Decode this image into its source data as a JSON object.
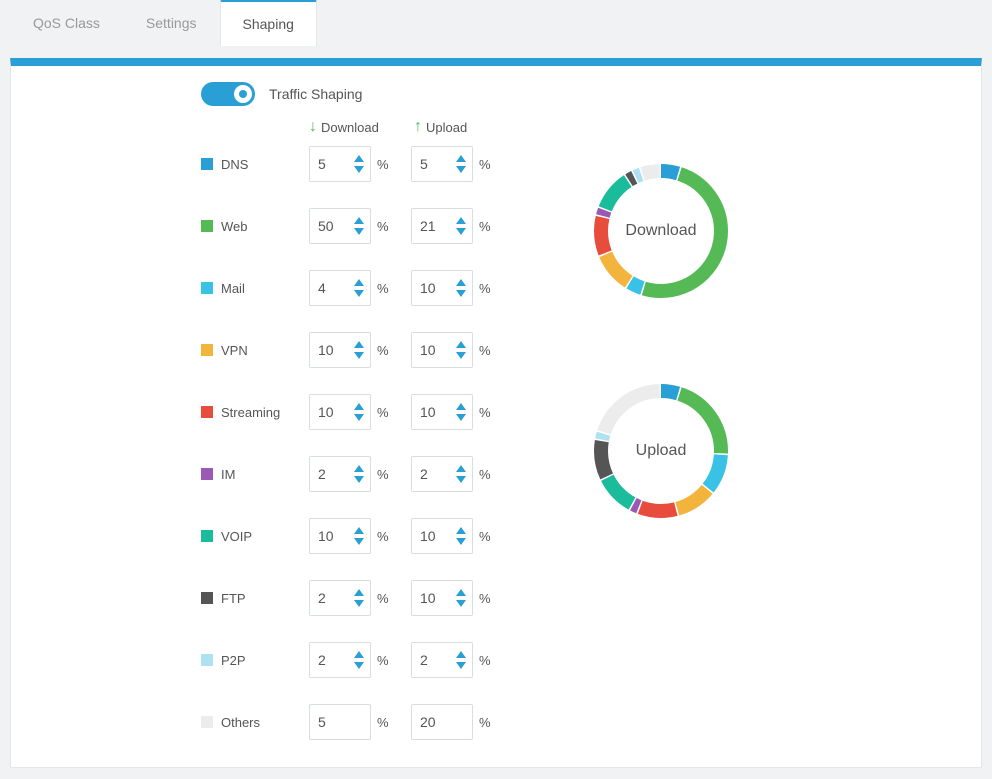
{
  "tabs": {
    "qos": "QoS Class",
    "settings": "Settings",
    "shaping": "Shaping"
  },
  "toggle_label": "Traffic Shaping",
  "columns": {
    "download": "Download",
    "upload": "Upload"
  },
  "percent_sign": "%",
  "rows": [
    {
      "label": "DNS",
      "color": "#2a9fd6",
      "download": "5",
      "upload": "5",
      "spinner": true
    },
    {
      "label": "Web",
      "color": "#55b955",
      "download": "50",
      "upload": "21",
      "spinner": true
    },
    {
      "label": "Mail",
      "color": "#39c1e6",
      "download": "4",
      "upload": "10",
      "spinner": true
    },
    {
      "label": "VPN",
      "color": "#f3b43e",
      "download": "10",
      "upload": "10",
      "spinner": true
    },
    {
      "label": "Streaming",
      "color": "#e84c3d",
      "download": "10",
      "upload": "10",
      "spinner": true
    },
    {
      "label": "IM",
      "color": "#9b59b6",
      "download": "2",
      "upload": "2",
      "spinner": true
    },
    {
      "label": "VOIP",
      "color": "#1abc9c",
      "download": "10",
      "upload": "10",
      "spinner": true
    },
    {
      "label": "FTP",
      "color": "#555555",
      "download": "2",
      "upload": "10",
      "spinner": true
    },
    {
      "label": "P2P",
      "color": "#aee2f2",
      "download": "2",
      "upload": "2",
      "spinner": true
    },
    {
      "label": "Others",
      "color": "#ececec",
      "download": "5",
      "upload": "20",
      "spinner": false
    }
  ],
  "chart_data": [
    {
      "type": "pie",
      "title": "Download",
      "series": [
        {
          "name": "DNS",
          "value": 5,
          "color": "#2a9fd6"
        },
        {
          "name": "Web",
          "value": 50,
          "color": "#55b955"
        },
        {
          "name": "Mail",
          "value": 4,
          "color": "#39c1e6"
        },
        {
          "name": "VPN",
          "value": 10,
          "color": "#f3b43e"
        },
        {
          "name": "Streaming",
          "value": 10,
          "color": "#e84c3d"
        },
        {
          "name": "IM",
          "value": 2,
          "color": "#9b59b6"
        },
        {
          "name": "VOIP",
          "value": 10,
          "color": "#1abc9c"
        },
        {
          "name": "FTP",
          "value": 2,
          "color": "#555555"
        },
        {
          "name": "P2P",
          "value": 2,
          "color": "#aee2f2"
        },
        {
          "name": "Others",
          "value": 5,
          "color": "#ececec"
        }
      ]
    },
    {
      "type": "pie",
      "title": "Upload",
      "series": [
        {
          "name": "DNS",
          "value": 5,
          "color": "#2a9fd6"
        },
        {
          "name": "Web",
          "value": 21,
          "color": "#55b955"
        },
        {
          "name": "Mail",
          "value": 10,
          "color": "#39c1e6"
        },
        {
          "name": "VPN",
          "value": 10,
          "color": "#f3b43e"
        },
        {
          "name": "Streaming",
          "value": 10,
          "color": "#e84c3d"
        },
        {
          "name": "IM",
          "value": 2,
          "color": "#9b59b6"
        },
        {
          "name": "VOIP",
          "value": 10,
          "color": "#1abc9c"
        },
        {
          "name": "FTP",
          "value": 10,
          "color": "#555555"
        },
        {
          "name": "P2P",
          "value": 2,
          "color": "#aee2f2"
        },
        {
          "name": "Others",
          "value": 20,
          "color": "#ececec"
        }
      ]
    }
  ]
}
